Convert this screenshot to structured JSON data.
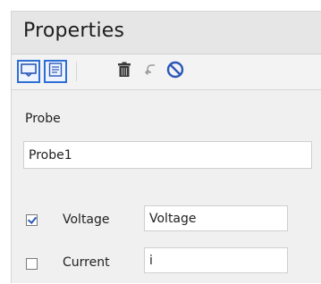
{
  "panel": {
    "title": "Properties"
  },
  "toolbar": {
    "items": [
      {
        "icon": "probe-icon",
        "selected": true
      },
      {
        "icon": "text-lines-icon",
        "selected": true
      },
      {
        "icon": "trash-icon",
        "selected": false
      },
      {
        "icon": "undo-arrow-icon",
        "selected": false
      },
      {
        "icon": "no-symbol-icon",
        "selected": false
      }
    ]
  },
  "form": {
    "probe_label": "Probe",
    "probe_value": "Probe1",
    "voltage": {
      "checked": true,
      "label": "Voltage",
      "value": "Voltage"
    },
    "current": {
      "checked": false,
      "label": "Current",
      "value": "i"
    }
  },
  "colors": {
    "accent": "#2e6fd6",
    "header_bg": "#e6e6e6",
    "panel_bg": "#f0f0f0",
    "icon_dark": "#3a3a3a",
    "icon_blue": "#2b58b8"
  }
}
